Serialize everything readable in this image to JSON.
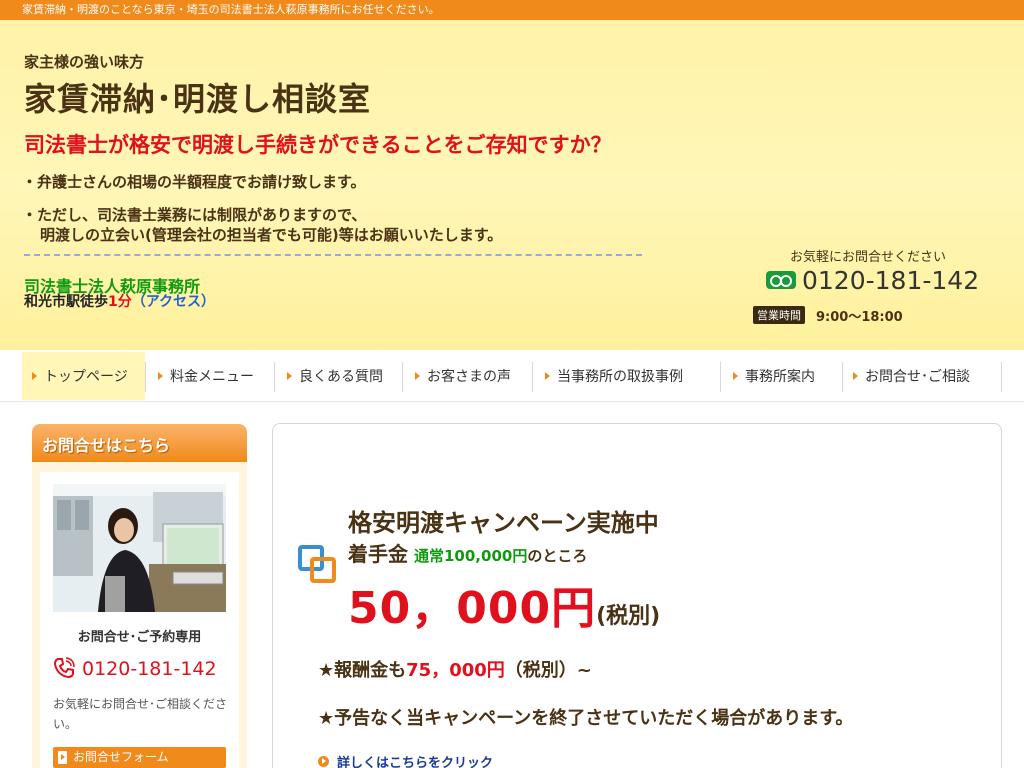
{
  "topbar": {
    "text": "家賃滞納・明渡のことなら東京・埼玉の司法書士法人萩原事務所にお任せください。"
  },
  "header": {
    "tagline": "家主様の強い味方",
    "title": "家賃滞納･明渡し相談室",
    "catch": "司法書士が格安で明渡し手続きができることをご存知ですか？",
    "bullet1": "・弁護士さんの相場の半額程度でお請け致します。",
    "bullet2": "・ただし、司法書士業務には制限がありますので、",
    "bullet3": "明渡しの立会い(管理会社の担当者でも可能)等はお願いいたします。",
    "office_name": "司法書士法人萩原事務所",
    "station_prefix": "和光市駅徒歩",
    "station_time": "1分",
    "access_link": "（アクセス）",
    "contact_caption": "お気軽にお問合せください",
    "freedial_icon": "freedial-icon",
    "tel": "0120-181-142",
    "hours_badge": "営業時間",
    "hours": "9:00〜18:00"
  },
  "nav": {
    "items": [
      {
        "label": "トップページ"
      },
      {
        "label": "料金メニュー"
      },
      {
        "label": "良くある質問"
      },
      {
        "label": "お客さまの声"
      },
      {
        "label": "当事務所の取扱事例"
      },
      {
        "label": "事務所案内"
      },
      {
        "label": "お問合せ･ご相談"
      }
    ]
  },
  "sidebar": {
    "heading": "お問合せはこちら",
    "label": "お問合せ･ご予約専用",
    "tel": "0120-181-142",
    "note": "お気軽にお問合せ･ご相談ください。",
    "form_button": "お問合せフォーム"
  },
  "campaign": {
    "title": "格安明渡キャンペーン実施中",
    "fee_label": "着手金",
    "fee_normal": "通常100,000円",
    "fee_tail": "のところ",
    "price": "50，000円",
    "tax": "(税別)",
    "reward_prefix": "★報酬金も",
    "reward_price": "75，000円",
    "reward_suffix": "（税別）~",
    "notice": "★予告なく当キャンペーンを終了させていただく場合があります。",
    "more_link": "詳しくはこちらをクリック"
  },
  "colors": {
    "accent": "#ef8a1b",
    "header_bg": "#fff2a8",
    "red": "#e0101c",
    "green": "#109a10",
    "brown": "#4a3215"
  }
}
